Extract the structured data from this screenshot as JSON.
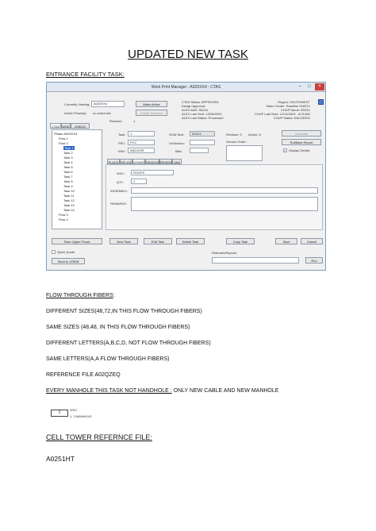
{
  "title": "UPDATED NEW TASK",
  "section_label": "ENTRANCE FACILITY TASK:",
  "window": {
    "title": "Work Print Manager - A0Z0XX4 - CTAS",
    "currently_viewing_label": "Currently Viewing:",
    "currently_viewing_value": "A0Z0XX4",
    "active_flows_label": "Active Flows(s):",
    "active_flows_value": "no active tab",
    "revision_label": "Revision:",
    "revision_value": "1",
    "make_active_label": "Make Active",
    "create_revision_label": "Create Revision",
    "status_lines": [
      "CTAS Status: APPROVED",
      "Design Approval:",
      "ALEX A&R: 5S224",
      "ALEX Last Sent: 12/28/2023",
      "ALEX Last Status: Processed"
    ],
    "region_lines": [
      "Region: SOUTHWEST",
      "Sales Center: Roseline 518374",
      "CHUP Name: 5S224",
      "CHUP Last Sent: 12/13/2023 - 6:29 AM",
      "CHUP Status: ENCODED"
    ],
    "tabs": [
      "CTAS",
      "WOE",
      "OSE/JV TASK"
    ],
    "tree_items": [
      {
        "label": "Phase A0Z0XX4",
        "depth": 0
      },
      {
        "label": "Flow 1",
        "depth": 1
      },
      {
        "label": "Flow 2",
        "depth": 1
      },
      {
        "label": "Task 1",
        "depth": 2,
        "selected": true
      },
      {
        "label": "Task 2",
        "depth": 2
      },
      {
        "label": "Task 3",
        "depth": 2
      },
      {
        "label": "Task 4",
        "depth": 2
      },
      {
        "label": "Task 5",
        "depth": 2
      },
      {
        "label": "Task 6",
        "depth": 2
      },
      {
        "label": "Task 7",
        "depth": 2
      },
      {
        "label": "Task 8",
        "depth": 2
      },
      {
        "label": "Task 9",
        "depth": 2
      },
      {
        "label": "Task 10",
        "depth": 2
      },
      {
        "label": "Task 11",
        "depth": 2
      },
      {
        "label": "Task 12",
        "depth": 2
      },
      {
        "label": "Task 13",
        "depth": 2
      },
      {
        "label": "Task 14",
        "depth": 2
      },
      {
        "label": "Flow 3",
        "depth": 1
      },
      {
        "label": "Flow 4",
        "depth": 1
      }
    ],
    "field_task_label": "Task:",
    "field_task_value": "1",
    "field_frc_label": "FRC:",
    "field_frc_value": "PCC",
    "field_env_label": "ENV:",
    "field_env_value": "ANCHOR",
    "field_sowsize_label": "SOW Size:",
    "field_sowsize_value": "5S224",
    "field_onsection_label": "OnSection:",
    "field_bills_label": "Bills:",
    "field_revision_label": "Revision: 0",
    "field_action_label": "Action: U",
    "field_service_order_label": "Service Order:",
    "annotate_label": "Annotate",
    "rollback_label": "RollBack Report",
    "display_details_label": "Display Details",
    "inner_tabs": [
      "PLACE",
      "SPLICE",
      "OTHER",
      "REMOVE",
      "REVIEW",
      "DIM"
    ],
    "wsc_label": "WSC:",
    "wsc_value": "ROOFS",
    "qty_label": "QTY:",
    "qty_value": "1",
    "assembly_label": "ASSEMBLY:",
    "remarks_label": "REMARKS:",
    "bottom_buttons": [
      "Save Upper Flows",
      "New Task",
      "Edit Task",
      "Delete Task",
      "Copy Task",
      "Save",
      "Cancel"
    ],
    "quick_quote_label": "Quick Quote",
    "send_to_crew_label": "Send to CREW",
    "referrals_label": "Referrals/Reports",
    "run_label": "Run"
  },
  "lines": {
    "flow_through_fibers": "FLOW THROUGH FIBERS",
    "flow_colon": ":",
    "different_sizes": "DIFFERENT SIZES(48,72,IN THIS FLOW THROUGH FIBERS)",
    "same_sizes": "SAME SIZES (48,48, IN THIS FLOW THROUGH FIBERS)",
    "different_letters": "DIFFERENT LETTERS(A,B,C,D, NOT FLOW THROUGH FIBERS)",
    "same_letters": "SAME LETTERS(A,A FLOW THROUGH FIBERS)",
    "reference_file": "REFERENCE FILE A02QZEQ",
    "manhole_underlined": "EVERY MANHOLE THIS TASK NOT HANDHOLE :",
    "manhole_rest": " ONLY NEW CABLE AND NEW MANHOLE"
  },
  "mini_icon": {
    "number": "1",
    "text1": "WSC",
    "text2": "1. 3 MANHOLE"
  },
  "cell_tower_title": "CELL TOWER REFERNCE FILE:",
  "cell_tower_file": "A0251HT"
}
